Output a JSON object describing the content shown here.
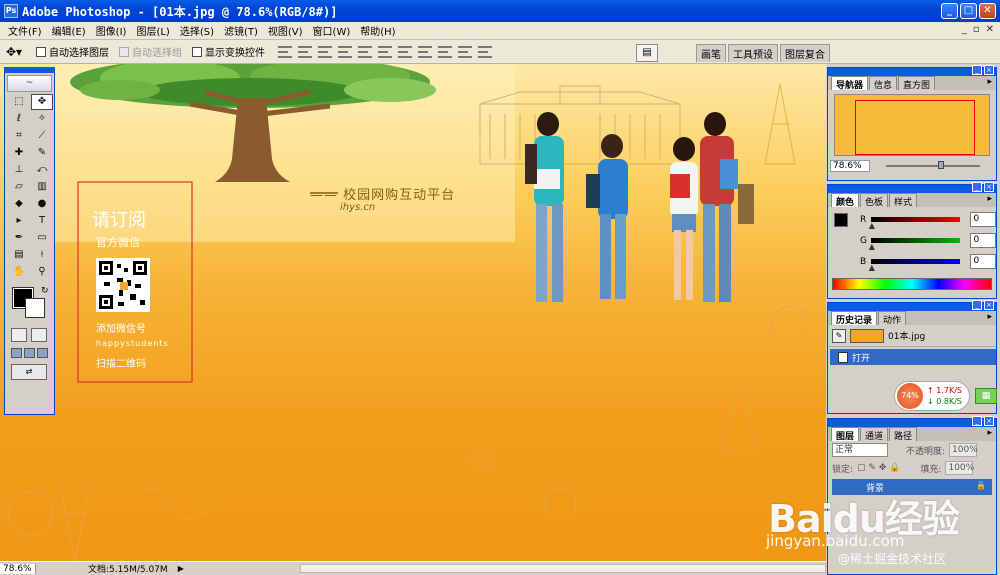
{
  "window": {
    "title": "Adobe Photoshop - [01本.jpg @ 78.6%(RGB/8#)]",
    "icon_label": "Ps",
    "buttons": [
      "_",
      "□",
      "✕"
    ]
  },
  "menu": {
    "items": [
      "文件(F)",
      "编辑(E)",
      "图像(I)",
      "图层(L)",
      "选择(S)",
      "滤镜(T)",
      "视图(V)",
      "窗口(W)",
      "帮助(H)"
    ],
    "doc_controls": [
      "_",
      "▫",
      "✕"
    ]
  },
  "options_bar": {
    "tool_icon": "move-tool-icon",
    "auto_select_layer": "自动选择图层",
    "auto_select_group": "自动选择组",
    "show_transform": "显示变换控件"
  },
  "palette_well": {
    "tabs": [
      "画笔",
      "工具预设",
      "图层复合"
    ]
  },
  "canvas": {
    "tagline": "—— 校园网购互动平台",
    "site": "ihys.cn",
    "subscribe_title": "请订阅",
    "official_wechat": "官方微信",
    "add_wechat": "添加微信号",
    "wechat_id": "happystudents",
    "scan_qr": "扫描二维码",
    "colors": {
      "bg_top": "#fde9a8",
      "bg_bottom": "#ef9716",
      "text": "#ffffff",
      "tagline": "#8a5a10",
      "frame": "#e0322a"
    }
  },
  "status_bar": {
    "zoom": "78.6%",
    "doc_size": "文档:5.15M/5.07M"
  },
  "toolbox": {
    "feather_label": "~"
  },
  "navigator_panel": {
    "tabs": [
      "导航器",
      "信息",
      "直方图"
    ],
    "zoom": "78.6%"
  },
  "color_panel": {
    "tabs": [
      "颜色",
      "色板",
      "样式"
    ],
    "r_label": "R",
    "g_label": "G",
    "b_label": "B",
    "r_value": "0",
    "g_value": "0",
    "b_value": "0"
  },
  "history_panel": {
    "tabs": [
      "历史记录",
      "动作"
    ],
    "snapshot_name": "01本.jpg",
    "state_label": "打开"
  },
  "speed_widget": {
    "percent": "74%",
    "upload": "1.7K/S",
    "download": "0.8K/S"
  },
  "layers_panel": {
    "tabs": [
      "图层",
      "通道",
      "路径"
    ],
    "blend_mode": "正常",
    "opacity_label": "不透明度:",
    "opacity_value": "100%",
    "lock_label": "锁定:",
    "fill_label": "填充:",
    "fill_value": "100%",
    "layer_name": "背景"
  },
  "watermark": {
    "logo": "Baidu经验",
    "url": "jingyan.baidu.com",
    "credit": "@稀土掘金技术社区"
  }
}
